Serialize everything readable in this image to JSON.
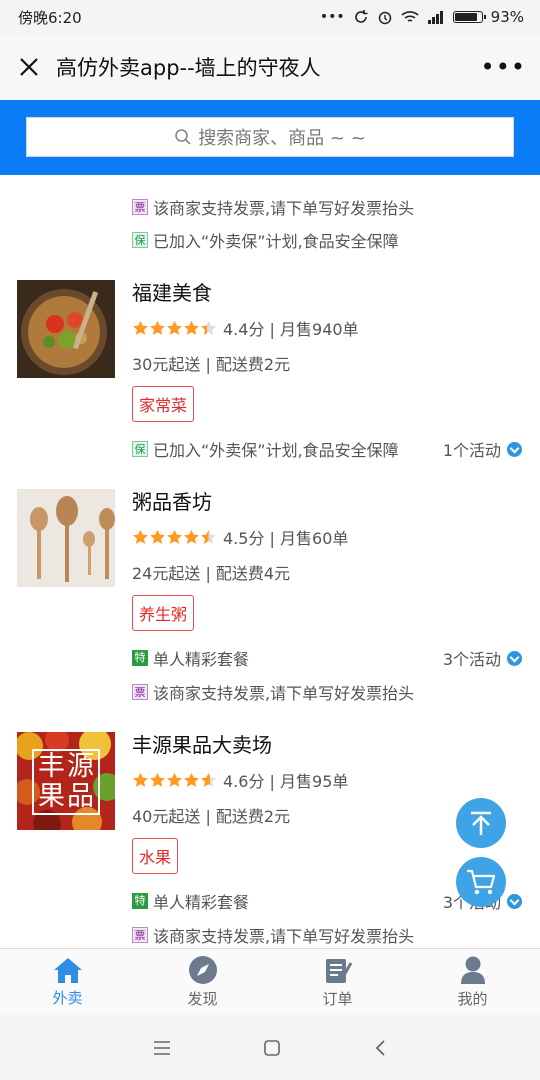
{
  "status_bar": {
    "time": "傍晚6:20",
    "battery": "93%",
    "battery_level": 0.93
  },
  "title_bar": {
    "title": "高仿外卖app--墙上的守夜人",
    "more": "•••"
  },
  "search": {
    "placeholder": "搜索商家、商品 ~ ~"
  },
  "colors": {
    "brand_blue": "#0a7cf7",
    "star": "#ff9a1f",
    "tag_red": "#e84b4b",
    "tab_active": "#2f8de4"
  },
  "top_partial": {
    "lines": [
      {
        "badge": "票",
        "text": "该商家支持发票,请下单写好发票抬头"
      },
      {
        "badge": "保",
        "text": "已加入“外卖保”计划,食品安全保障"
      }
    ]
  },
  "shops": [
    {
      "name": "福建美食",
      "rating": 4.4,
      "rating_text": "4.4分 | 月售940单",
      "fee": "30元起送 | 配送费2元",
      "tag": "家常菜",
      "lines": [
        {
          "badge": "保",
          "text": "已加入“外卖保”计划,食品安全保障"
        }
      ],
      "activity": "1个活动"
    },
    {
      "name": "粥品香坊",
      "rating": 4.5,
      "rating_text": "4.5分 | 月售60单",
      "fee": "24元起送 | 配送费4元",
      "tag": "养生粥",
      "lines": [
        {
          "badge": "特",
          "text": "单人精彩套餐"
        },
        {
          "badge": "票",
          "text": "该商家支持发票,请下单写好发票抬头"
        }
      ],
      "activity": "3个活动"
    },
    {
      "name": "丰源果品大卖场",
      "rating": 4.6,
      "rating_text": "4.6分 | 月售95单",
      "fee": "40元起送 | 配送费2元",
      "tag": "水果",
      "logo_text": "丰源果品",
      "lines": [
        {
          "badge": "特",
          "text": "单人精彩套餐"
        },
        {
          "badge": "票",
          "text": "该商家支持发票,请下单写好发票抬头"
        }
      ],
      "activity": "3个活动"
    }
  ],
  "tabs": [
    {
      "label": "外卖",
      "icon": "home-icon",
      "active": true
    },
    {
      "label": "发现",
      "icon": "compass-icon",
      "active": false
    },
    {
      "label": "订单",
      "icon": "order-icon",
      "active": false
    },
    {
      "label": "我的",
      "icon": "user-icon",
      "active": false
    }
  ]
}
